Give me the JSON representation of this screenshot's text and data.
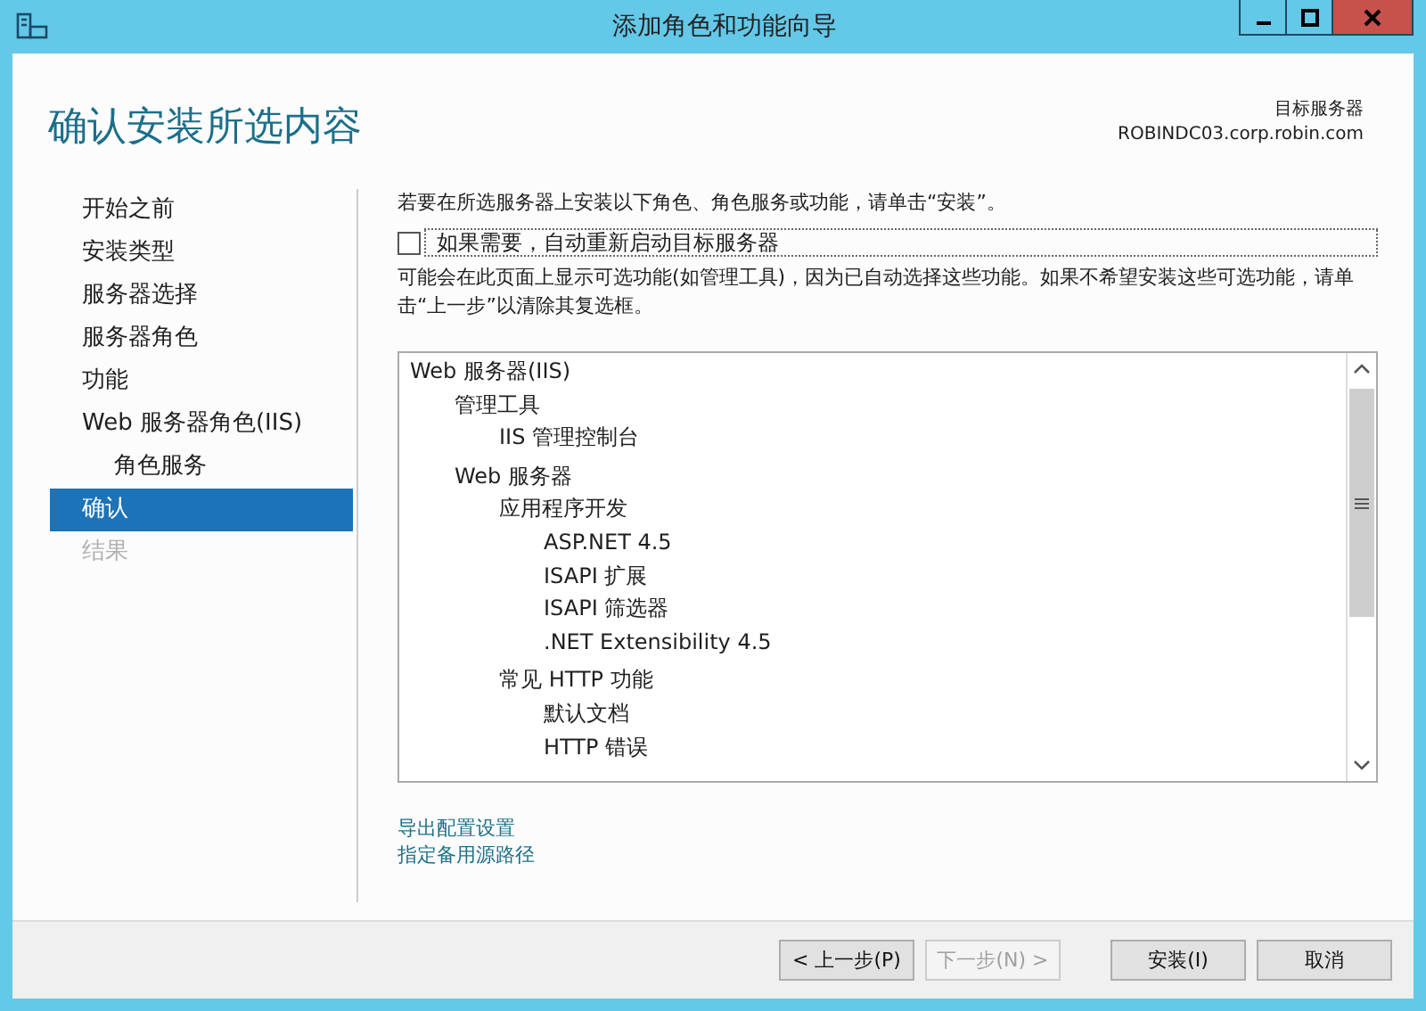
{
  "window": {
    "title": "添加角色和功能向导"
  },
  "header": {
    "title": "确认安装所选内容",
    "target_label": "目标服务器",
    "target_server": "ROBINDC03.corp.robin.com"
  },
  "sidebar": {
    "items": [
      {
        "label": "开始之前",
        "selected": false,
        "disabled": false
      },
      {
        "label": "安装类型",
        "selected": false,
        "disabled": false
      },
      {
        "label": "服务器选择",
        "selected": false,
        "disabled": false
      },
      {
        "label": "服务器角色",
        "selected": false,
        "disabled": false
      },
      {
        "label": "功能",
        "selected": false,
        "disabled": false
      },
      {
        "label": "Web 服务器角色(IIS)",
        "selected": false,
        "disabled": false,
        "children": [
          {
            "label": "角色服务",
            "selected": false,
            "disabled": false
          }
        ]
      },
      {
        "label": "确认",
        "selected": true,
        "disabled": false
      },
      {
        "label": "结果",
        "selected": false,
        "disabled": true
      }
    ]
  },
  "content": {
    "intro": "若要在所选服务器上安装以下角色、角色服务或功能，请单击“安装”。",
    "restart_checkbox": {
      "label": "如果需要，自动重新启动目标服务器",
      "checked": false
    },
    "note": "可能会在此页面上显示可选功能(如管理工具)，因为已自动选择这些功能。如果不希望安装这些可选功能，请单击“上一步”以清除其复选框。",
    "tree": [
      {
        "label": "Web 服务器(IIS)",
        "children": [
          {
            "label": "管理工具",
            "children": [
              {
                "label": "IIS 管理控制台"
              }
            ]
          },
          {
            "label": "Web 服务器",
            "children": [
              {
                "label": "应用程序开发",
                "children": [
                  {
                    "label": "ASP.NET 4.5"
                  },
                  {
                    "label": "ISAPI 扩展"
                  },
                  {
                    "label": "ISAPI 筛选器"
                  },
                  {
                    "label": ".NET Extensibility 4.5"
                  }
                ]
              },
              {
                "label": "常见 HTTP 功能",
                "children": [
                  {
                    "label": "默认文档"
                  },
                  {
                    "label": "HTTP 错误"
                  }
                ]
              }
            ]
          }
        ]
      }
    ],
    "links": [
      "导出配置设置",
      "指定备用源路径"
    ]
  },
  "buttons": [
    {
      "label": "< 上一步(P)",
      "disabled": false
    },
    {
      "label": "下一步(N) >",
      "disabled": true
    },
    {
      "label": "安装(I)",
      "disabled": false
    },
    {
      "label": "取消",
      "disabled": false
    }
  ]
}
